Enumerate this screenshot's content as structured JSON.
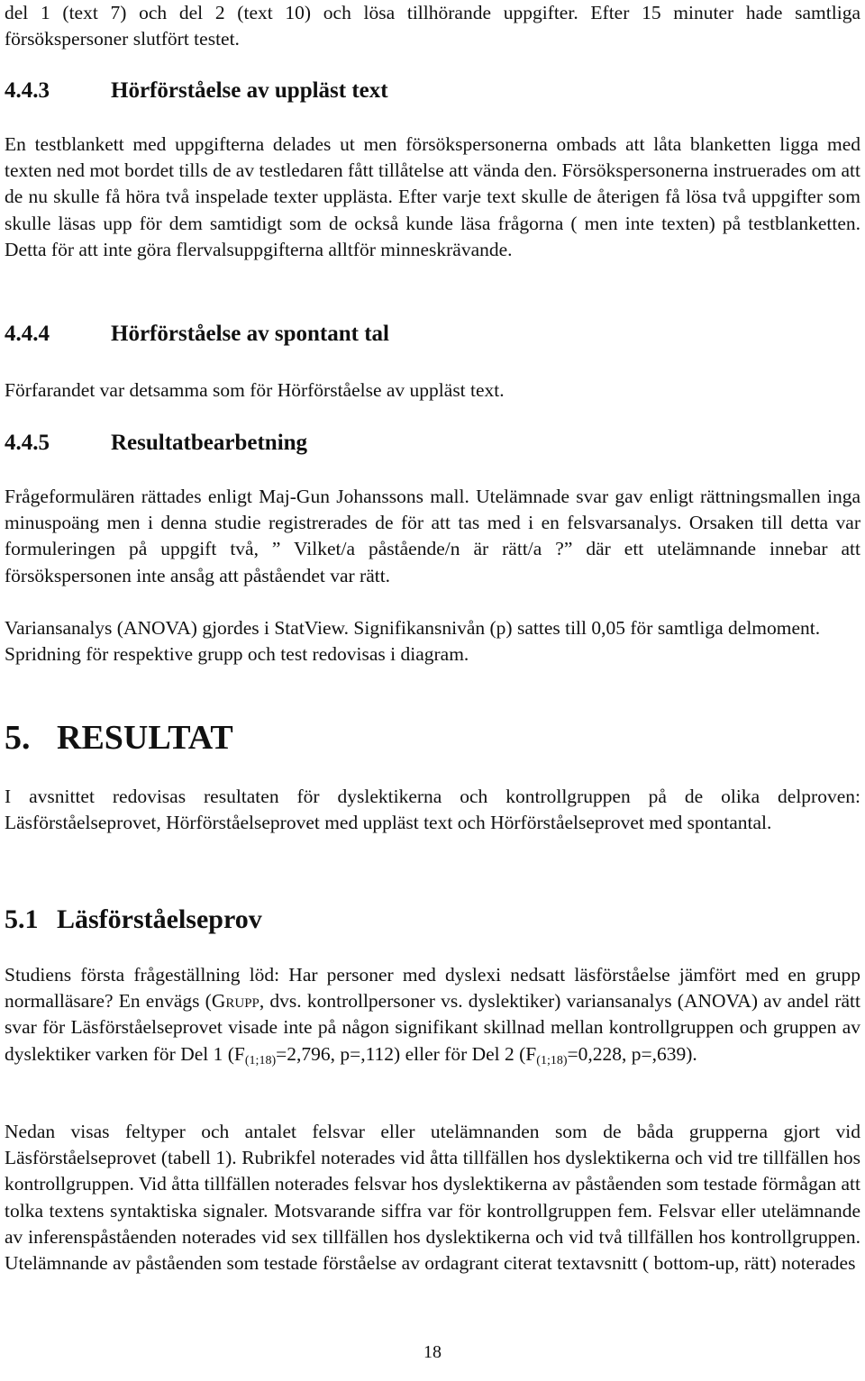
{
  "document": {
    "intro_paragraph": "del 1 (text 7) och del 2 (text 10) och lösa tillhörande uppgifter. Efter 15 minuter hade samtliga försökspersoner slutfört testet.",
    "sections": [
      {
        "number": "4.4.3",
        "title": "Hörförståelse av uppläst text",
        "paragraphs": [
          "En testblankett med uppgifterna delades ut men försökspersonerna ombads att låta blanketten ligga med texten ned mot bordet tills de av testledaren fått tillåtelse att vända den. Försökspersonerna instruerades om att de nu skulle få höra två inspelade texter upplästa. Efter varje text skulle de återigen få lösa två uppgifter som skulle läsas upp för dem samtidigt som de också kunde läsa frågorna ( men inte texten)  på testblanketten. Detta för att inte göra flervalsuppgifterna alltför minneskrävande."
        ]
      },
      {
        "number": "4.4.4",
        "title": "Hörförståelse av spontant tal",
        "paragraphs": [
          "Förfarandet var detsamma som för Hörförståelse av uppläst text."
        ]
      },
      {
        "number": "4.4.5",
        "title": "Resultatbearbetning",
        "paragraphs": [
          "Frågeformulären rättades enligt Maj-Gun Johanssons mall. Utelämnade svar gav enligt rättningsmallen inga minuspoäng men i denna studie registrerades de för att tas med i en felsvarsanalys. Orsaken till detta var formuleringen på uppgift två, ” Vilket/a  påstående/n  är rätt/a ?” där ett utelämnande innebar att försökspersonen inte ansåg att påståendet var rätt.",
          "Variansanalys (ANOVA) gjordes i StatView. Signifikansnivån (p) sattes till 0,05 för samtliga delmoment. Spridning för respektive grupp och test redovisas i diagram."
        ]
      }
    ],
    "chapter": {
      "number": "5.",
      "title": "RESULTAT",
      "paragraph": "I avsnittet redovisas resultaten för dyslektikerna och kontrollgruppen på de olika delproven: Läsförståelseprovet, Hörförståelseprovet med uppläst text och Hörförståelseprovet med spontantal."
    },
    "subsection": {
      "number": "5.1",
      "title": "Läsförståelseprov",
      "p1_part1": "Studiens första frågeställning löd: Har personer med dyslexi nedsatt läsförståelse jämfört med en grupp normalläsare?  En envägs (",
      "p1_smallcaps": "Grupp",
      "p1_part2": ", dvs. kontrollpersoner vs. dyslektiker) variansanalys (ANOVA) av andel rätt svar för Läsförståelseprovet visade inte på någon signifikant skillnad mellan kontrollgruppen och gruppen av dyslektiker varken för Del 1 (F",
      "stat1_sub": "(1;18)",
      "stat1_rest": "=2,796, p=,112) eller för Del 2 (F",
      "stat2_sub": "(1;18)",
      "stat2_rest": "=0,228, p=,639).",
      "p2": "Nedan visas feltyper och antalet felsvar eller utelämnanden som de båda grupperna gjort vid Läsförståelseprovet (tabell 1). Rubrikfel noterades vid åtta tillfällen hos dyslektikerna och vid tre tillfällen hos kontrollgruppen. Vid åtta tillfällen noterades felsvar hos dyslektikerna av påståenden som testade förmågan att tolka textens syntaktiska signaler. Motsvarande siffra var för kontrollgruppen fem. Felsvar eller utelämnande av inferenspåståenden noterades vid sex tillfällen hos dyslektikerna och vid två tillfällen hos kontrollgruppen. Utelämnande av påståenden som testade förståelse av ordagrant citerat textavsnitt ( bottom-up, rätt) noterades"
    },
    "page_number": "18"
  }
}
